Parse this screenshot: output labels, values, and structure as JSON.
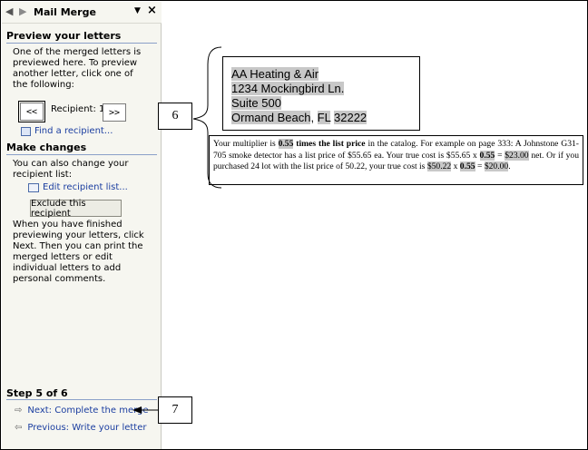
{
  "pane": {
    "title": "Mail Merge",
    "preview_heading": "Preview your letters",
    "preview_text": "One of the merged letters is previewed here. To preview another letter, click one of the following:",
    "prev_label": "<<",
    "recipient_label": "Recipient: 1",
    "next_label": ">>",
    "find_recipient": "Find a recipient...",
    "changes_heading": "Make changes",
    "changes_text": "You can also change your recipient list:",
    "edit_recipient_list": "Edit recipient list...",
    "exclude_label": "Exclude this recipient",
    "finish_text": "When you have finished previewing your letters, click Next. Then you can print the merged letters or edit individual letters to add personal comments.",
    "step_label": "Step 5 of 6",
    "next_step": "Next: Complete the merge",
    "prev_step": "Previous: Write your letter"
  },
  "document": {
    "address": [
      "AA Heating & Air",
      "1234 Mockingbird Ln.",
      "Suite 500",
      "Ormand Beach",
      ", ",
      "FL",
      " ",
      "32222"
    ],
    "paragraph": {
      "t1": "Your multiplier is ",
      "m1": "0.55",
      "t2": " times the list price",
      "t3": " in the catalog. For example on page 333:  A Johnstone G31-705 smoke detector has a list price of $55.65 ea. Your true cost is $55.65 x ",
      "m2": "0.55",
      "t4": " = ",
      "m3": "$23.00",
      "t5": " net. Or if you purchased 24 lot with the list price of 50.22, your true cost is ",
      "m4": "$50.22",
      "t6": " x ",
      "m5": "0.55",
      "t7": " = ",
      "m6": "$20.00",
      "t8": "."
    }
  },
  "callouts": {
    "c6": "6",
    "c7": "7"
  }
}
